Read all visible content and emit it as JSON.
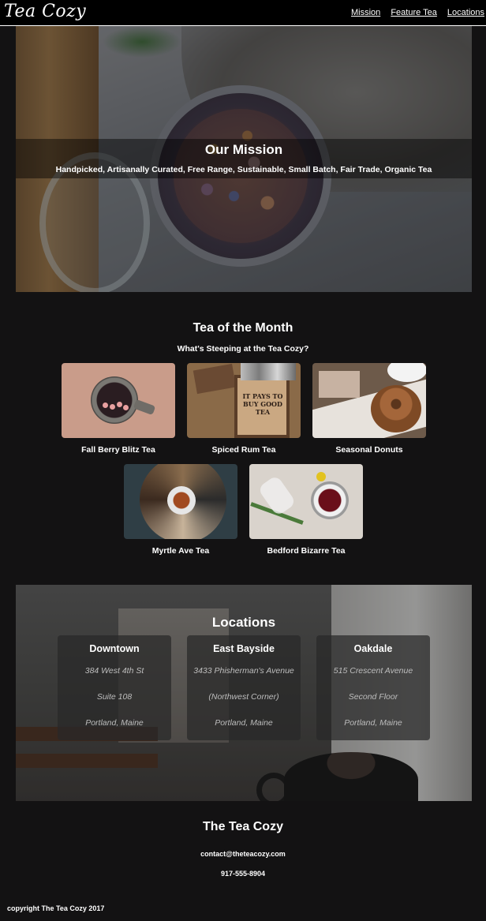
{
  "header": {
    "logo": "Tea Cozy",
    "nav": [
      "Mission",
      "Feature Tea",
      "Locations"
    ]
  },
  "mission": {
    "title": "Our Mission",
    "subtitle": "Handpicked, Artisanally Curated, Free Range, Sustainable, Small Batch, Fair Trade, Organic Tea"
  },
  "tea_of_month": {
    "title": "Tea of the Month",
    "subtitle": "What's Steeping at the Tea Cozy?",
    "items": [
      {
        "name": "Fall Berry Blitz Tea"
      },
      {
        "name": "Spiced Rum Tea"
      },
      {
        "name": "Seasonal Donuts"
      },
      {
        "name": "Myrtle Ave Tea"
      },
      {
        "name": "Bedford Bizarre Tea"
      }
    ],
    "box_text": "IT PAYS TO BUY GOOD TEA"
  },
  "locations": {
    "title": "Locations",
    "items": [
      {
        "name": "Downtown",
        "lines": [
          "384 West 4th St",
          "Suite 108",
          "Portland, Maine"
        ]
      },
      {
        "name": "East Bayside",
        "lines": [
          "3433 Phisherman's Avenue",
          "(Northwest Corner)",
          "Portland, Maine"
        ]
      },
      {
        "name": "Oakdale",
        "lines": [
          "515 Crescent Avenue",
          "Second Floor",
          "Portland, Maine"
        ]
      }
    ]
  },
  "footer": {
    "title": "The Tea Cozy",
    "email": "contact@theteacozy.com",
    "phone": "917-555-8904",
    "copyright": "copyright The Tea Cozy 2017"
  },
  "colors": {
    "background": "#131213",
    "header_bg": "#000000",
    "text": "#ffffff",
    "address_text": "#bdbdbd"
  }
}
